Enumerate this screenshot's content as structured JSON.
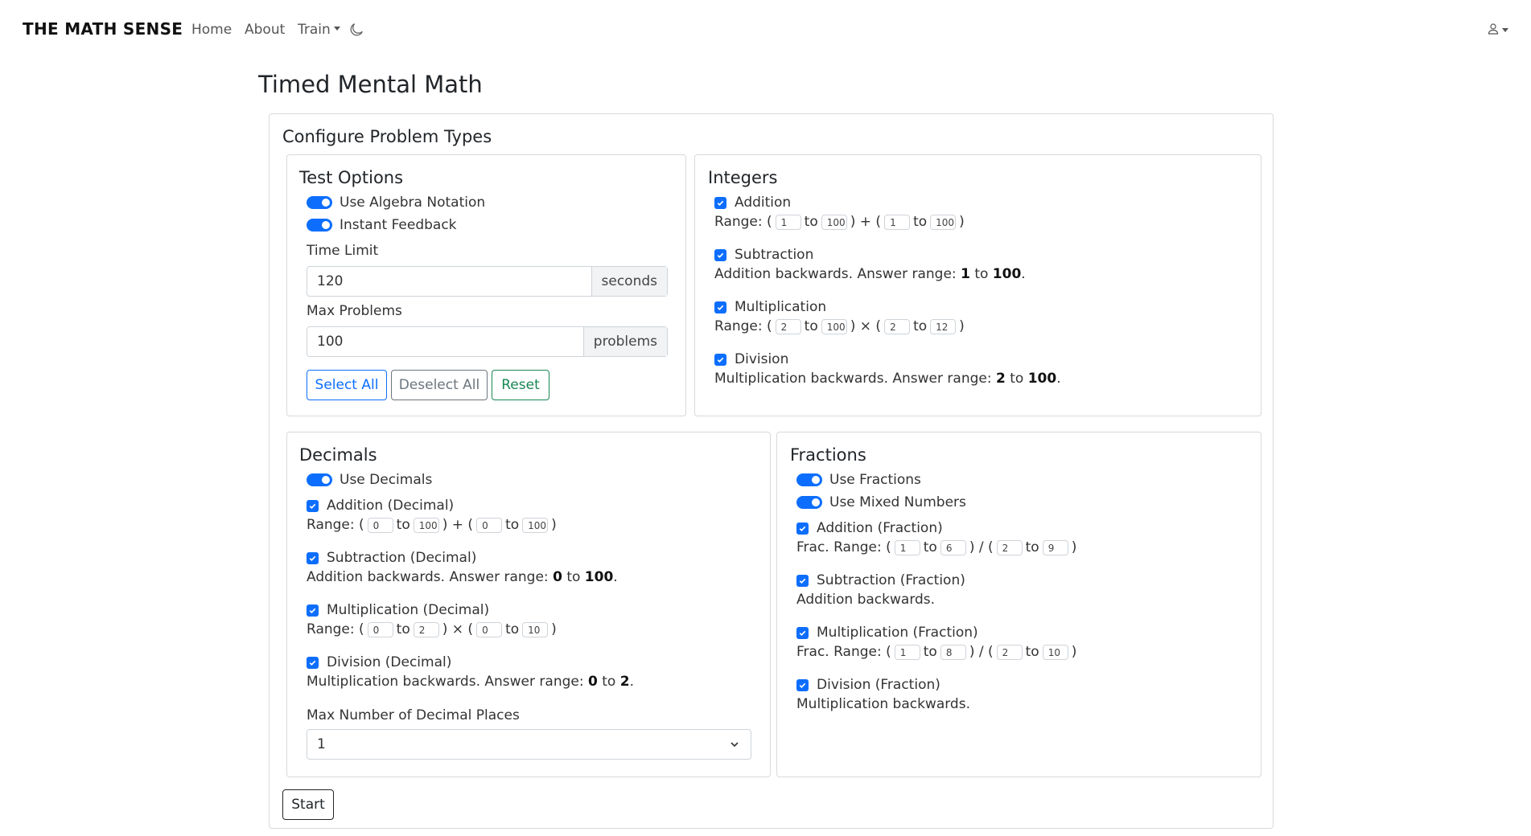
{
  "nav": {
    "brand": "THE MATH SENSE",
    "home": "Home",
    "about": "About",
    "train": "Train"
  },
  "page": {
    "title": "Timed Mental Math"
  },
  "config": {
    "title": "Configure Problem Types",
    "start_label": "Start"
  },
  "test_options": {
    "title": "Test Options",
    "use_algebra": "Use Algebra Notation",
    "instant_feedback": "Instant Feedback",
    "time_limit_label": "Time Limit",
    "time_limit_value": "120",
    "time_limit_unit": "seconds",
    "max_problems_label": "Max Problems",
    "max_problems_value": "100",
    "max_problems_unit": "problems",
    "select_all": "Select All",
    "deselect_all": "Deselect All",
    "reset": "Reset"
  },
  "integers": {
    "title": "Integers",
    "addition": {
      "label": "Addition",
      "a_min": "1",
      "a_max": "100",
      "b_min": "1",
      "b_max": "100"
    },
    "subtraction": {
      "label": "Subtraction",
      "desc": "Addition backwards. Answer range:",
      "ans_min": "1",
      "ans_max": "100"
    },
    "multiplication": {
      "label": "Multiplication",
      "a_min": "2",
      "a_max": "100",
      "b_min": "2",
      "b_max": "12"
    },
    "division": {
      "label": "Division",
      "desc": "Multiplication backwards. Answer range:",
      "ans_min": "2",
      "ans_max": "100"
    }
  },
  "decimals": {
    "title": "Decimals",
    "use_decimals": "Use Decimals",
    "addition": {
      "label": "Addition (Decimal)",
      "a_min": "0",
      "a_max": "100",
      "b_min": "0",
      "b_max": "100"
    },
    "subtraction": {
      "label": "Subtraction (Decimal)",
      "desc": "Addition backwards. Answer range:",
      "ans_min": "0",
      "ans_max": "100"
    },
    "multiplication": {
      "label": "Multiplication (Decimal)",
      "a_min": "0",
      "a_max": "2",
      "b_min": "0",
      "b_max": "10"
    },
    "division": {
      "label": "Division (Decimal)",
      "desc": "Multiplication backwards. Answer range:",
      "ans_min": "0",
      "ans_max": "2"
    },
    "max_places_label": "Max Number of Decimal Places",
    "max_places_value": "1"
  },
  "fractions": {
    "title": "Fractions",
    "use_fractions": "Use Fractions",
    "use_mixed": "Use Mixed Numbers",
    "addition": {
      "label": "Addition (Fraction)",
      "a_min": "1",
      "a_max": "6",
      "b_min": "2",
      "b_max": "9"
    },
    "subtraction": {
      "label": "Subtraction (Fraction)",
      "desc": "Addition backwards."
    },
    "multiplication": {
      "label": "Multiplication (Fraction)",
      "a_min": "1",
      "a_max": "8",
      "b_min": "2",
      "b_max": "10"
    },
    "division": {
      "label": "Division (Fraction)",
      "desc": "Multiplication backwards."
    }
  },
  "text": {
    "range": "Range: (",
    "frac_range": "Frac. Range: (",
    "to": "to",
    "close": ")",
    "plus_open": ") + (",
    "times_open": ") × (",
    "div_open": ") / (",
    "period": "."
  },
  "colors": {
    "primary": "#0d6efd",
    "success": "#198754",
    "secondary": "#6c757d"
  },
  "icons": {
    "theme": "moon-icon",
    "user": "user-icon",
    "check": "check-icon",
    "select": "chevron-down-icon"
  }
}
